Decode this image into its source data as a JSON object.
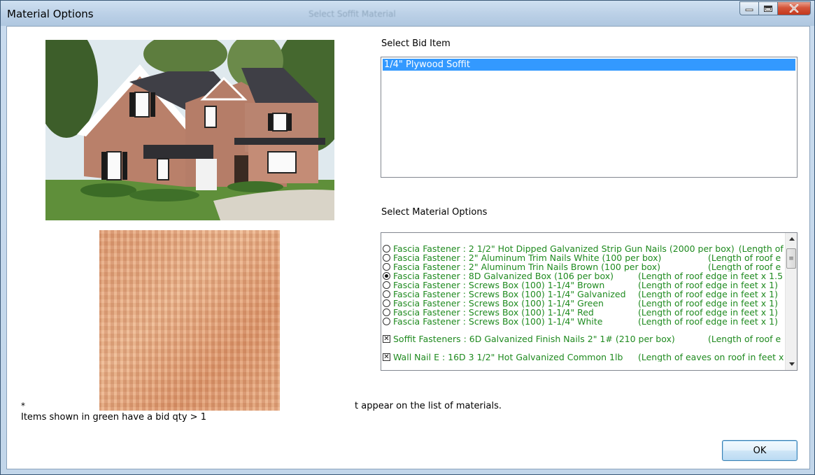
{
  "window": {
    "title": "Material Options",
    "background_title": "Select Soffit Material",
    "minimize_icon": "minimize-icon",
    "maximize_icon": "maximize-icon",
    "close_icon": "close-icon"
  },
  "bid_section": {
    "label": "Select Bid Item",
    "items": [
      "1/4\" Plywood Soffit"
    ],
    "selected_index": 0
  },
  "material_section": {
    "label": "Select Material Options",
    "rows": [
      {
        "control": "radio",
        "selected": false,
        "name": "Fascia Fastener : 2 1/2\" Hot Dipped Galvanized Strip Gun Nails (2000 per box)",
        "qty": "(Length of roof e"
      },
      {
        "control": "radio",
        "selected": false,
        "name": "Fascia Fastener : 2\" Aluminum Trim Nails White (100 per box)",
        "qty": "(Length of roof e"
      },
      {
        "control": "radio",
        "selected": false,
        "name": "Fascia Fastener : 2\" Aluminum Trin Nails Brown (100 per box)",
        "qty": "(Length of roof e"
      },
      {
        "control": "radio",
        "selected": true,
        "name": "Fascia Fastener : 8D Galvanized Box (106 per box)",
        "qty": "(Length of roof edge in feet x 1.5"
      },
      {
        "control": "radio",
        "selected": false,
        "name": "Fascia Fastener : Screws Box (100) 1-1/4\" Brown",
        "qty": "(Length of roof edge in feet x 1)"
      },
      {
        "control": "radio",
        "selected": false,
        "name": "Fascia Fastener : Screws Box (100) 1-1/4\" Galvanized",
        "qty": "(Length of roof edge in feet x 1)"
      },
      {
        "control": "radio",
        "selected": false,
        "name": "Fascia Fastener : Screws Box (100) 1-1/4\" Green",
        "qty": "(Length of roof edge in feet x 1)"
      },
      {
        "control": "radio",
        "selected": false,
        "name": "Fascia Fastener : Screws Box (100) 1-1/4\" Red",
        "qty": "(Length of roof edge in feet x 1)"
      },
      {
        "control": "radio",
        "selected": false,
        "name": "Fascia Fastener : Screws Box (100) 1-1/4\" White",
        "qty": "(Length of roof edge in feet x 1)"
      },
      {
        "control": "checkbox",
        "selected": true,
        "name": "Soffit Fasteners : 6D Galvanized Finish Nails 2\" 1# (210 per box)",
        "qty": "(Length of roof e"
      },
      {
        "control": "checkbox",
        "selected": true,
        "name": "Wall Nail E : 16D 3 1/2\" Hot Galvanized Common 1lb",
        "qty": "(Length of eaves on roof in feet x"
      }
    ],
    "scroll_up_icon": "scroll-up-icon",
    "scroll_down_icon": "scroll-down-icon",
    "scroll_thumb_glyph": "≡"
  },
  "notes": {
    "asterisk": "*",
    "partial_note": "t appear on the list of materials.",
    "green_note": "Items shown in green have a bid qty > 1"
  },
  "buttons": {
    "ok_label": "OK"
  },
  "colors": {
    "selection": "#3399ff",
    "green_text": "#1f8a1f",
    "close_button": "#c3381d"
  }
}
